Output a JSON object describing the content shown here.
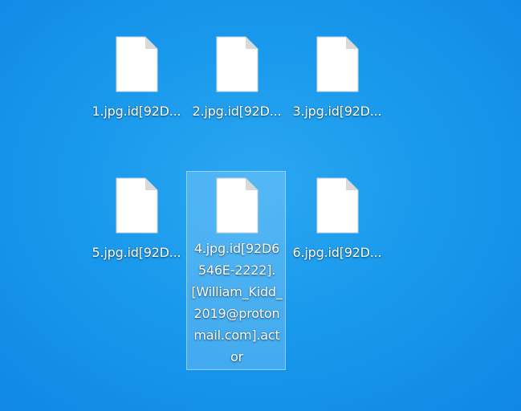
{
  "desktop": {
    "files": [
      {
        "name": "1.jpg.id[92D...",
        "icon": "blank-document-icon",
        "selected": false
      },
      {
        "name": "2.jpg.id[92D...",
        "icon": "blank-document-icon",
        "selected": false
      },
      {
        "name": "3.jpg.id[92D...",
        "icon": "blank-document-icon",
        "selected": false
      },
      {
        "name": "5.jpg.id[92D...",
        "icon": "blank-document-icon",
        "selected": false
      },
      {
        "name": "4.jpg.id[92D6546E-2222].[William_Kidd_2019@protonmail.com].actor",
        "icon": "blank-document-icon",
        "selected": true
      },
      {
        "name": "6.jpg.id[92D...",
        "icon": "blank-document-icon",
        "selected": false
      }
    ]
  },
  "colors": {
    "desktop_background": "#1898ec",
    "selection_fill": "#c8e6ff",
    "icon_page": "#ffffff",
    "icon_fold": "#dcdcdc"
  }
}
